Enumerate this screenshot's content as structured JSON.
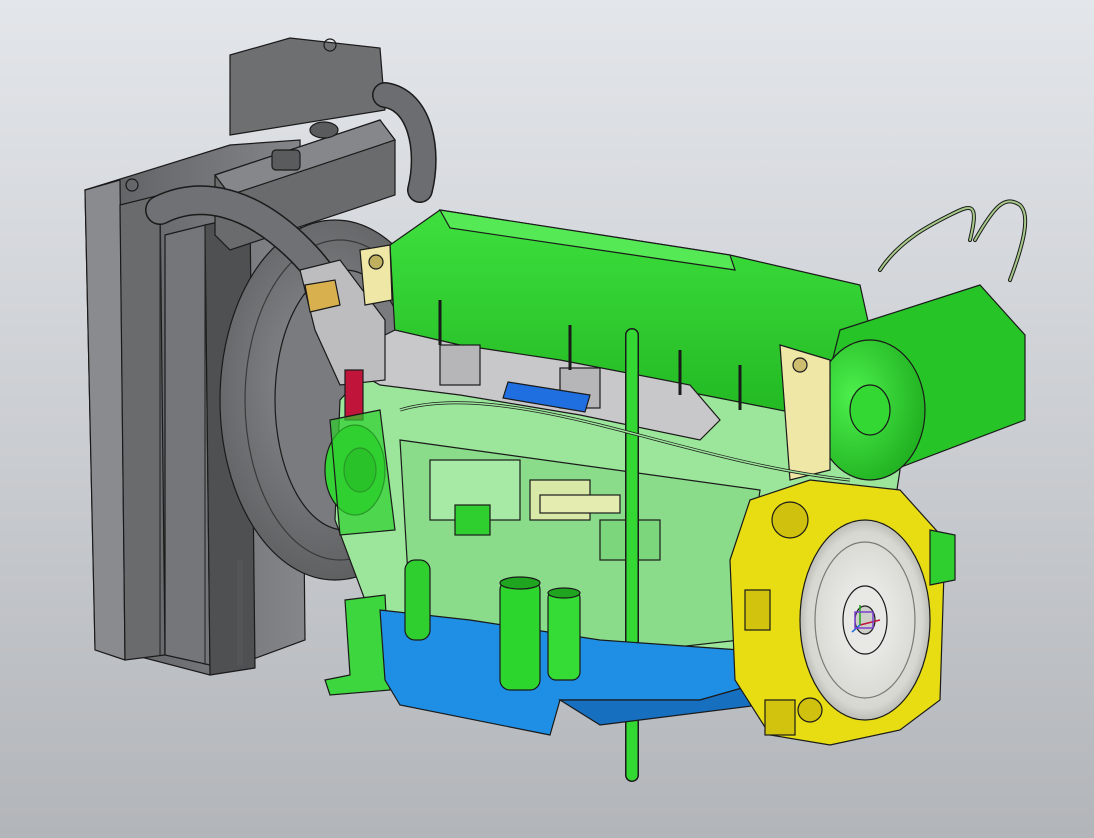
{
  "scene": {
    "kind": "cad-3d-viewport",
    "model": "diesel-generator-engine-assembly",
    "background": {
      "top": "#e3e6ea",
      "bottom": "#b2b5b9"
    },
    "colors": {
      "radiator": "#7b7c7e",
      "radiator_dark": "#5f6062",
      "hose": "#6e6f71",
      "engine_body": "#2fd82f",
      "engine_light": "#9fe69f",
      "engine_dark": "#1fa51f",
      "oil_pan": "#1e8fe4",
      "flywheel_housing": "#e8dc12",
      "bracket_pale": "#efe7a6",
      "manifold": "#c9c9cb",
      "sticker_blue": "#1f6fe0",
      "accent_red": "#c0143a",
      "outline": "#1a1a1a"
    }
  }
}
